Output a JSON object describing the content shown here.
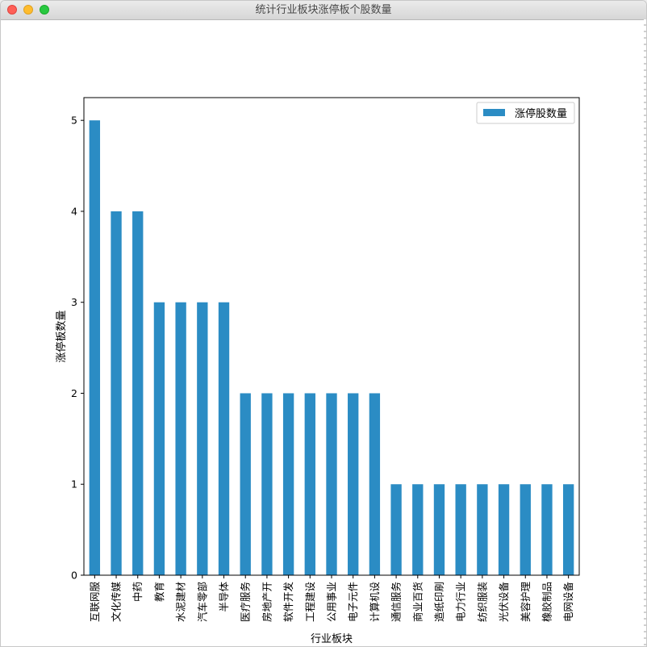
{
  "window": {
    "title": "统计行业板块涨停板个股数量"
  },
  "colors": {
    "bar": "#2b8cc4",
    "axis": "#000000",
    "titlebar_text": "#4a4a4a"
  },
  "chart_data": {
    "type": "bar",
    "title": "",
    "xlabel": "行业板块",
    "ylabel": "涨停板数量",
    "ylim": [
      0,
      5.25
    ],
    "yticks": [
      0,
      1,
      2,
      3,
      4,
      5
    ],
    "legend": {
      "placement": "top-right",
      "entries": [
        "涨停股数量"
      ]
    },
    "grid": false,
    "categories": [
      "互联网服",
      "文化传媒",
      "中药",
      "教育",
      "水泥建材",
      "汽车零部",
      "半导体",
      "医疗服务",
      "房地产开",
      "软件开发",
      "工程建设",
      "公用事业",
      "电子元件",
      "计算机设",
      "通信服务",
      "商业百货",
      "造纸印刷",
      "电力行业",
      "纺织服装",
      "光伏设备",
      "美容护理",
      "橡胶制品",
      "电网设备"
    ],
    "series": [
      {
        "name": "涨停股数量",
        "values": [
          5,
          4,
          4,
          3,
          3,
          3,
          3,
          2,
          2,
          2,
          2,
          2,
          2,
          2,
          1,
          1,
          1,
          1,
          1,
          1,
          1,
          1,
          1
        ]
      }
    ]
  }
}
